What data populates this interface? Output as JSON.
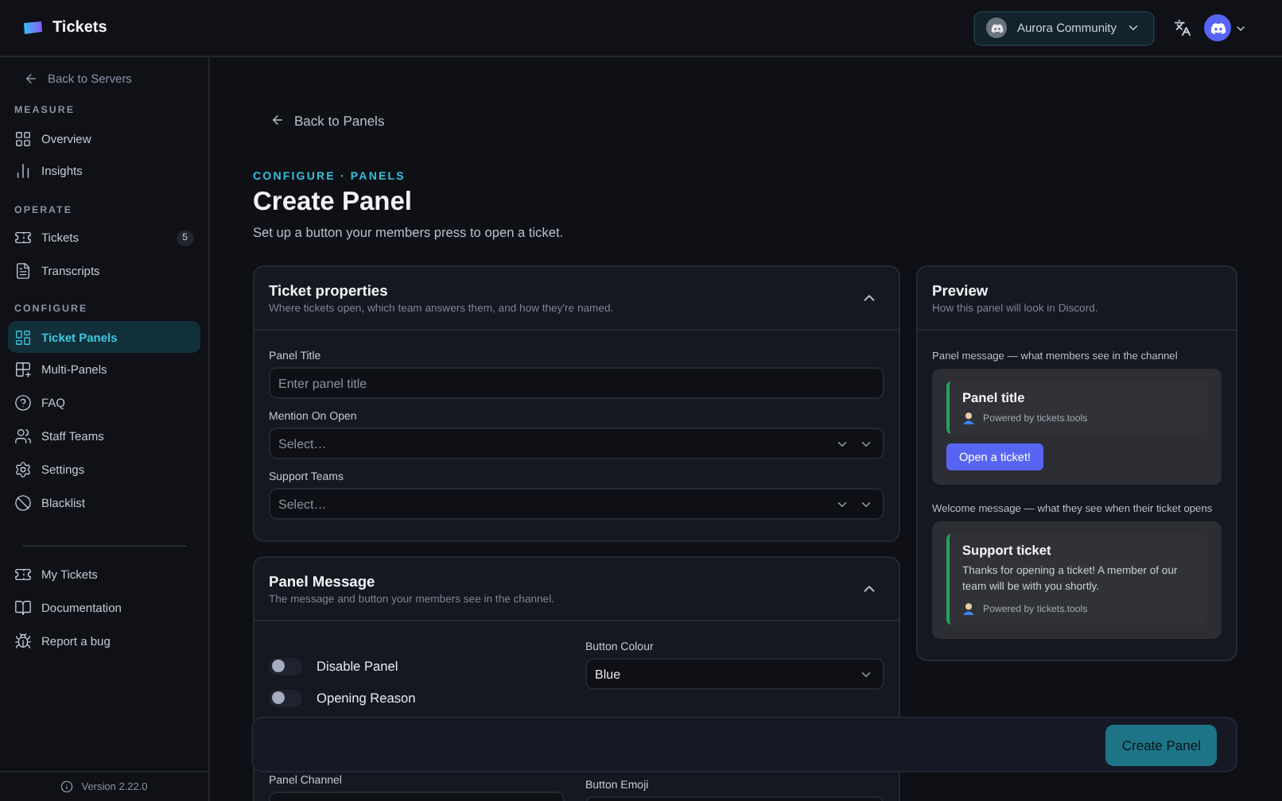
{
  "header": {
    "app_name": "Tickets",
    "server": "Aurora Community"
  },
  "sidebar": {
    "back_link": "Back to Servers",
    "sections": [
      {
        "title": "MEASURE",
        "items": [
          {
            "label": "Overview",
            "selected": false
          },
          {
            "label": "Insights",
            "selected": false
          }
        ]
      },
      {
        "title": "OPERATE",
        "items": [
          {
            "label": "Tickets",
            "selected": false,
            "badge": "5"
          },
          {
            "label": "Transcripts",
            "selected": false
          }
        ]
      },
      {
        "title": "CONFIGURE",
        "items": [
          {
            "label": "Ticket Panels",
            "selected": true
          },
          {
            "label": "Multi-Panels",
            "selected": false
          },
          {
            "label": "FAQ",
            "selected": false
          },
          {
            "label": "Staff Teams",
            "selected": false
          },
          {
            "label": "Settings",
            "selected": false
          },
          {
            "label": "Blacklist",
            "selected": false
          }
        ]
      }
    ],
    "links": [
      {
        "label": "My Tickets"
      },
      {
        "label": "Documentation"
      },
      {
        "label": "Report a bug"
      }
    ],
    "version": "Version 2.22.0"
  },
  "page": {
    "back_link": "Back to Panels",
    "eyebrow": "CONFIGURE · PANELS",
    "title": "Create Panel",
    "subtitle": "Set up a button your members press to open a ticket."
  },
  "ticket_properties": {
    "title": "Ticket properties",
    "description": "Where tickets open, which team answers them, and how they're named.",
    "expanded": true,
    "fields": [
      {
        "label": "Panel Title",
        "placeholder": "Enter panel title",
        "kind": "text"
      },
      {
        "label": "Mention On Open",
        "placeholder": "Select…",
        "kind": "multiselect"
      },
      {
        "label": "Support Teams",
        "placeholder": "Select…",
        "kind": "multiselect"
      }
    ]
  },
  "panel_message": {
    "title": "Panel Message",
    "description": "The message and button your members see in the channel.",
    "expanded": true,
    "toggles": [
      {
        "label": "Disable Panel",
        "on": false
      },
      {
        "label": "Opening Reason",
        "on": false
      }
    ],
    "button_colour": {
      "label": "Button Colour",
      "value": "Blue"
    },
    "panel_channel": {
      "label": "Panel Channel"
    },
    "button_emoji": {
      "label": "Button Emoji"
    }
  },
  "preview": {
    "title": "Preview",
    "description": "How this panel will look in Discord.",
    "panel_caption": "Panel message — what members see in the channel",
    "panel_embed": {
      "title": "Panel title",
      "footer": "Powered by tickets.tools",
      "button": "Open a ticket!"
    },
    "welcome_caption": "Welcome message — what they see when their ticket opens",
    "welcome_embed": {
      "title": "Support ticket",
      "body": "Thanks for opening a ticket! A member of our team will be with you shortly.",
      "footer": "Powered by tickets.tools"
    }
  },
  "action_bar": {
    "button": "Create Panel"
  }
}
